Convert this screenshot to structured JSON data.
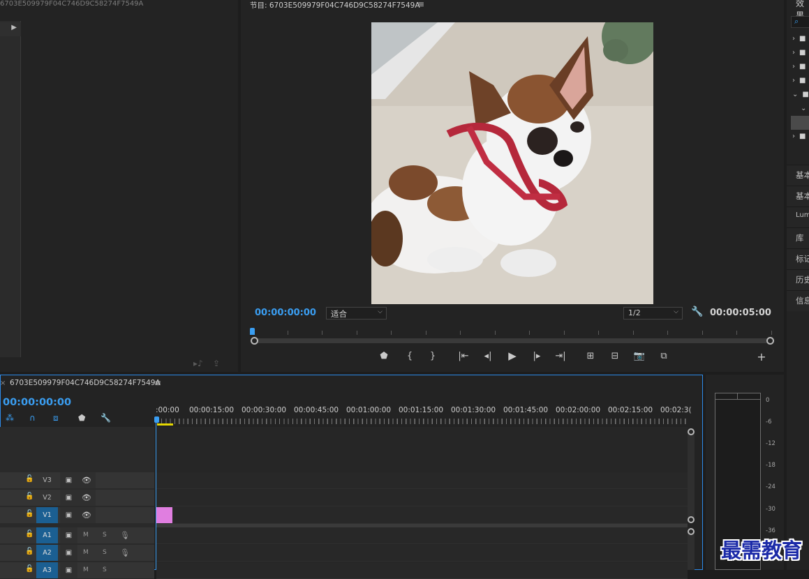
{
  "source": {
    "title": "6703E509979F04C746D9C58274F7549A"
  },
  "program": {
    "title": "节目: 6703E509979F04C746D9C58274F7549A",
    "timecode_in": "00:00:00:00",
    "fit_label": "适合",
    "resolution": "1/2",
    "duration": "00:00:05:00"
  },
  "timeline": {
    "title": "6703E509979F04C746D9C58274F7549A",
    "timecode": "00:00:00:00",
    "ruler_labels": [
      ":00:00",
      "00:00:15:00",
      "00:00:30:00",
      "00:00:45:00",
      "00:01:00:00",
      "00:01:15:00",
      "00:01:30:00",
      "00:01:45:00",
      "00:02:00:00",
      "00:02:15:00",
      "00:02:3("
    ],
    "tracks": {
      "v3": "V3",
      "v2": "V2",
      "v1": "V1",
      "a1": "A1",
      "a2": "A2",
      "a3": "A3",
      "mute": "M",
      "solo": "S"
    }
  },
  "meter": {
    "db_labels": [
      "0",
      "-6",
      "-12",
      "-18",
      "-24",
      "-30",
      "-36"
    ]
  },
  "effects": {
    "title": "效果"
  },
  "right_panels": {
    "p1": "基本",
    "p2": "基本",
    "p3": "Lum",
    "p4": "库",
    "p5": "标记",
    "p6": "历史",
    "p7": "信息"
  },
  "watermark": "最需教育",
  "colors": {
    "accent": "#3a9ef2",
    "clip": "#e07ee0",
    "track_selected": "#1b5f92"
  }
}
